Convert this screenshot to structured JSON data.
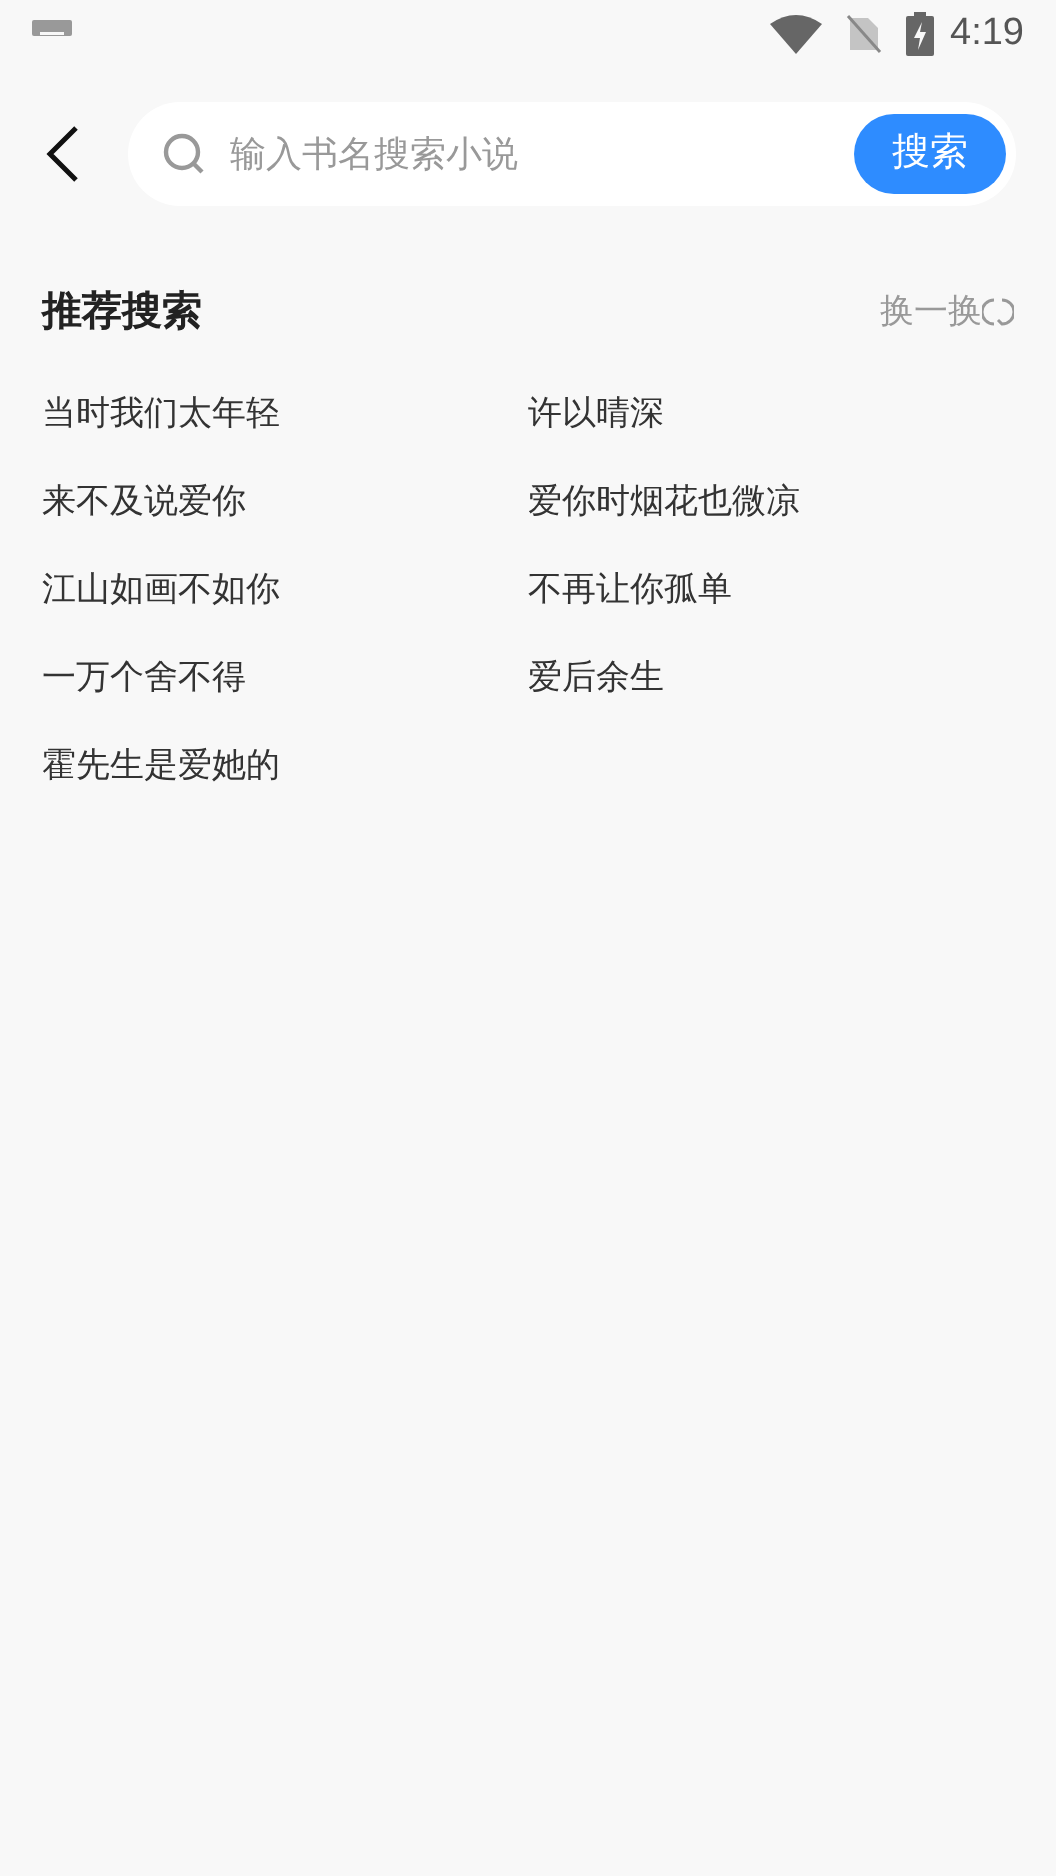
{
  "status_bar": {
    "time": "4:19"
  },
  "search": {
    "placeholder": "输入书名搜索小说",
    "button": "搜索"
  },
  "recommend": {
    "title": "推荐搜索",
    "refresh": "换一换",
    "items": [
      "当时我们太年轻",
      "许以晴深",
      "来不及说爱你",
      "爱你时烟花也微凉",
      "江山如画不如你",
      "不再让你孤单",
      "一万个舍不得",
      "爱后余生",
      "霍先生是爱她的"
    ]
  }
}
